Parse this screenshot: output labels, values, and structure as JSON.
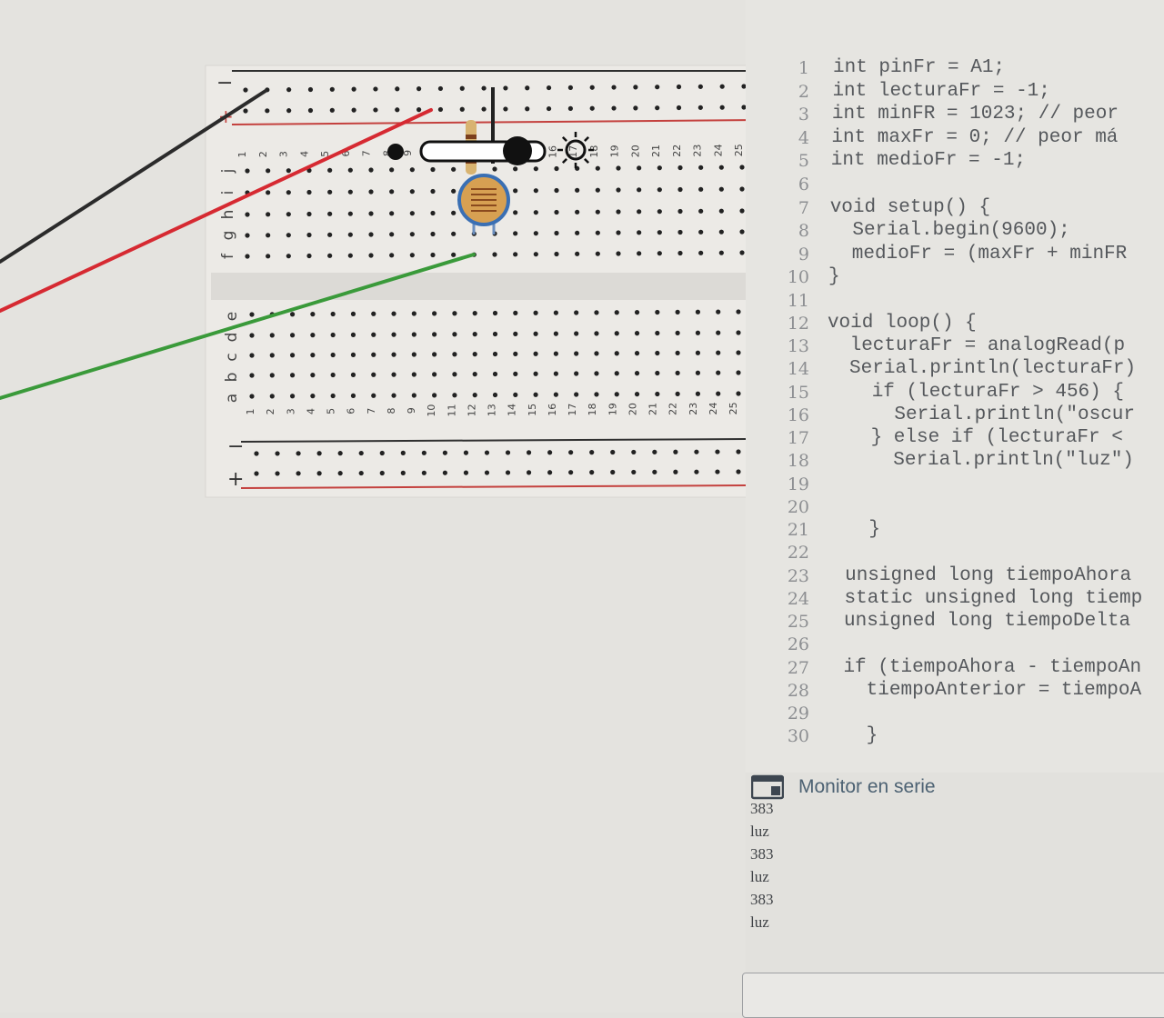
{
  "breadboard": {
    "column_numbers": [
      "1",
      "2",
      "3",
      "4",
      "5",
      "6",
      "7",
      "8",
      "9",
      "10",
      "11",
      "12",
      "13",
      "14",
      "15",
      "16",
      "17",
      "18",
      "19",
      "20",
      "21",
      "22",
      "23",
      "24",
      "25"
    ],
    "top_row_letters": [
      "j",
      "i",
      "h",
      "g",
      "f"
    ],
    "bottom_row_letters": [
      "e",
      "d",
      "c",
      "b",
      "a"
    ],
    "rail_minus": "−",
    "rail_plus": "+",
    "wire_colors": {
      "black": "#2b2b2b",
      "red": "#d62a32",
      "green": "#3a9a3a"
    },
    "rail_red": "#c4413e"
  },
  "code_editor": {
    "lines": [
      {
        "n": "1",
        "text": "int pinFr = A1;"
      },
      {
        "n": "2",
        "text": "int lecturaFr = -1;"
      },
      {
        "n": "3",
        "text": "int minFR = 1023; // peor"
      },
      {
        "n": "4",
        "text": "int maxFr = 0; // peor má"
      },
      {
        "n": "5",
        "text": "int medioFr = -1;"
      },
      {
        "n": "6",
        "text": ""
      },
      {
        "n": "7",
        "text": "void setup() {"
      },
      {
        "n": "8",
        "text": "  Serial.begin(9600);"
      },
      {
        "n": "9",
        "text": "  medioFr = (maxFr + minFR"
      },
      {
        "n": "10",
        "text": "}"
      },
      {
        "n": "11",
        "text": ""
      },
      {
        "n": "12",
        "text": "void loop() {"
      },
      {
        "n": "13",
        "text": "  lecturaFr = analogRead(p"
      },
      {
        "n": "14",
        "text": "  Serial.println(lecturaFr)"
      },
      {
        "n": "15",
        "text": "    if (lecturaFr > 456) {"
      },
      {
        "n": "16",
        "text": "      Serial.println(\"oscur"
      },
      {
        "n": "17",
        "text": "    } else if (lecturaFr <"
      },
      {
        "n": "18",
        "text": "      Serial.println(\"luz\")"
      },
      {
        "n": "19",
        "text": ""
      },
      {
        "n": "20",
        "text": ""
      },
      {
        "n": "21",
        "text": "    }"
      },
      {
        "n": "22",
        "text": ""
      },
      {
        "n": "23",
        "text": "  unsigned long tiempoAhora"
      },
      {
        "n": "24",
        "text": "  static unsigned long tiemp"
      },
      {
        "n": "25",
        "text": "  unsigned long tiempoDelta"
      },
      {
        "n": "26",
        "text": ""
      },
      {
        "n": "27",
        "text": "  if (tiempoAhora - tiempoAn"
      },
      {
        "n": "28",
        "text": "    tiempoAnterior = tiempoA"
      },
      {
        "n": "29",
        "text": ""
      },
      {
        "n": "30",
        "text": "    }"
      }
    ]
  },
  "serial_monitor": {
    "title": "Monitor en serie",
    "output": [
      "383",
      "luz",
      "383",
      "luz",
      "383",
      "luz"
    ],
    "input_value": ""
  }
}
